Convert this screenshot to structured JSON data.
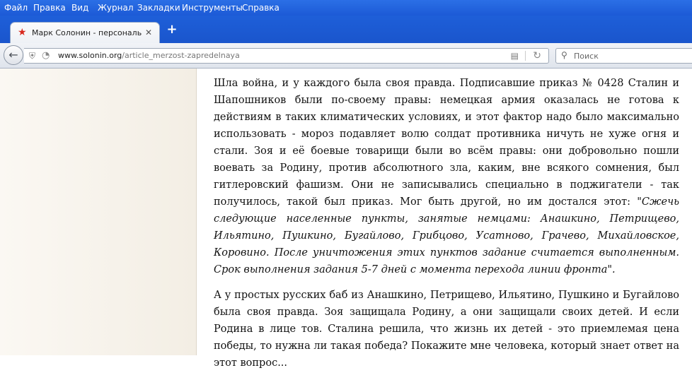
{
  "menu": [
    "Файл",
    "Правка",
    "Вид",
    "Журнал",
    "Закладки",
    "Инструменты",
    "Справка"
  ],
  "tab": {
    "title": "Марк Солонин - персональн...",
    "favicon": "red-star-icon"
  },
  "nav": {
    "url_domain": "www.solonin.org",
    "url_path": "/article_merzost-zapredelnaya",
    "search_placeholder": "Поиск"
  },
  "article": {
    "p1_before_quote": "Шла война, и у каждого была своя правда. Подписавшие приказ № 0428 Сталин и Шапошников были по-своему правы: немецкая армия оказалась не готова к действиям в таких климатических условиях, и этот фактор надо было максимально использовать - мороз подавляет волю солдат противника ничуть не хуже огня и стали. Зоя и её боевые товарищи были во всём правы: они добровольно пошли воевать за Родину, против абсолютного зла, каким, вне всякого сомнения, был гитлеровский фашизм. Они не записывались специально в поджигатели - так получилось, такой был приказ. Мог быть другой, но им достался этот: ",
    "p1_quote": "\"Сжечь следующие населенные пункты, занятые немцами: Анашкино, Петрищево, Ильятино, Пушкино, Бугайлово, Грибцово, Усатново, Грачево, Михайловское, Коровино. После уничтожения этих пунктов задание считается выполненным. Срок выполнения задания 5-7 дней с момента перехода линии фронта\".",
    "p2": "А у простых русских баб из Анашкино, Петрищево, Ильятино, Пушкино и Бугайлово была своя правда. Зоя защищала Родину, а они защищали своих детей. И если Родина в лице тов. Сталина решила, что жизнь их детей - это приемлемая цена победы, то нужна ли такая победа? Покажите мне человека, который знает ответ на этот вопрос..."
  }
}
